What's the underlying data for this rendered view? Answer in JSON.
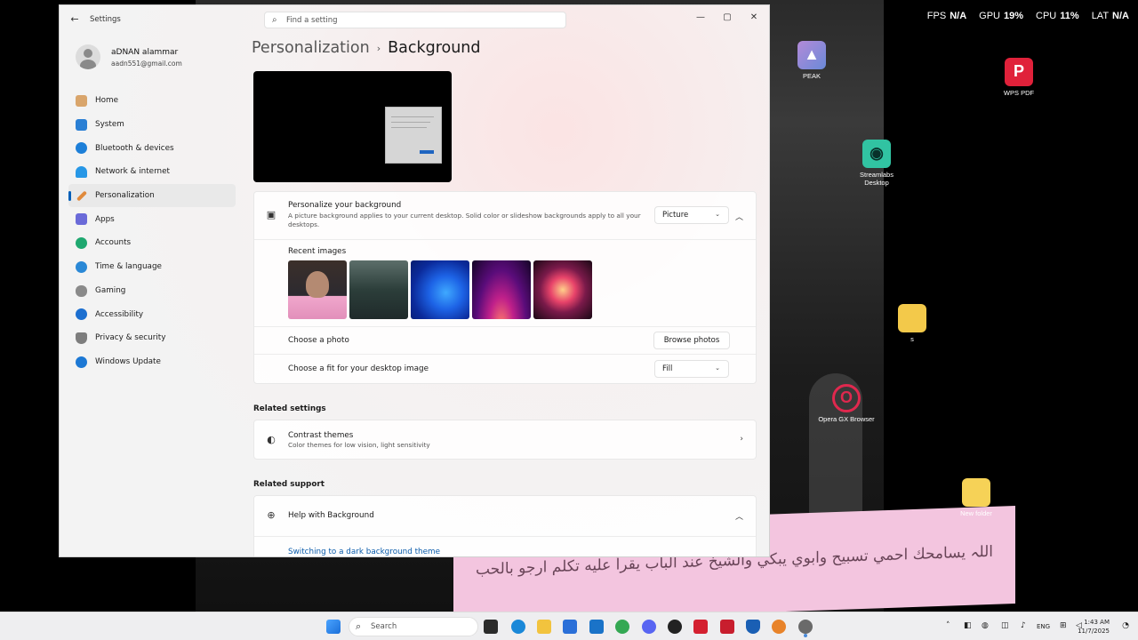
{
  "overlay": {
    "fps_label": "FPS",
    "fps_value": "N/A",
    "gpu_label": "GPU",
    "gpu_value": "19%",
    "cpu_label": "CPU",
    "cpu_value": "11%",
    "lat_label": "LAT",
    "lat_value": "N/A"
  },
  "desktop_icons": {
    "peak": "PEAK",
    "wps": "WPS PDF",
    "streamlabs": "Streamlabs Desktop",
    "folder_s": "s",
    "opera": "Opera GX Browser",
    "new_folder": "New folder"
  },
  "wallpaper_caption": "اللہ یسامحك احمي تسبيح وابوي يبكي والشيخ عند الباب يقرأ عليه تكلم ارجو بالحب",
  "window": {
    "title": "Settings",
    "search_placeholder": "Find a setting"
  },
  "profile": {
    "name": "aDNAN alammar",
    "email": "aadn551@gmail.com"
  },
  "nav": [
    {
      "label": "Home",
      "color": "#d9a56b"
    },
    {
      "label": "System",
      "color": "#2a7fd4"
    },
    {
      "label": "Bluetooth & devices",
      "color": "#1d7fd8"
    },
    {
      "label": "Network & internet",
      "color": "#2797e6"
    },
    {
      "label": "Personalization",
      "color": "#e08a3c"
    },
    {
      "label": "Apps",
      "color": "#6a6ad8"
    },
    {
      "label": "Accounts",
      "color": "#1fa870"
    },
    {
      "label": "Time & language",
      "color": "#2a88d6"
    },
    {
      "label": "Gaming",
      "color": "#8a8a8a"
    },
    {
      "label": "Accessibility",
      "color": "#1c6fd0"
    },
    {
      "label": "Privacy & security",
      "color": "#7d7d7d"
    },
    {
      "label": "Windows Update",
      "color": "#1c78d4"
    }
  ],
  "breadcrumb": {
    "parent": "Personalization",
    "separator": "›",
    "current": "Background"
  },
  "background_card": {
    "title": "Personalize your background",
    "description": "A picture background applies to your current desktop. Solid color or slideshow backgrounds apply to all your desktops.",
    "dropdown_value": "Picture",
    "recent_images_label": "Recent images",
    "choose_photo_label": "Choose a photo",
    "browse_button": "Browse photos",
    "fit_label": "Choose a fit for your desktop image",
    "fit_value": "Fill"
  },
  "related_settings": {
    "heading": "Related settings",
    "contrast_title": "Contrast themes",
    "contrast_desc": "Color themes for low vision, light sensitivity"
  },
  "related_support": {
    "heading": "Related support",
    "help_title": "Help with Background",
    "link": "Switching to a dark background theme"
  },
  "taskbar": {
    "search_label": "Search",
    "lang": "ENG",
    "time": "1:43 AM",
    "date": "11/7/2025"
  }
}
